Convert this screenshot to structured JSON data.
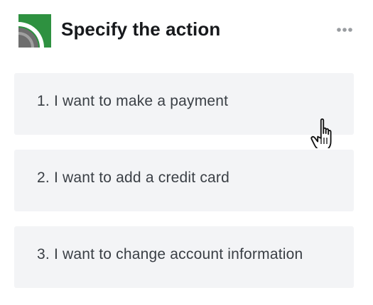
{
  "header": {
    "title": "Specify the action",
    "logo_icon": "road-logo-icon",
    "more_icon": "more-horizontal-icon"
  },
  "options": [
    {
      "label": "1. I want to make a payment"
    },
    {
      "label": "2. I want to add a credit card"
    },
    {
      "label": "3. I want to change account information"
    }
  ],
  "colors": {
    "logo_green": "#2e9140",
    "logo_gray": "#6e6e6e",
    "option_background": "#f3f4f6",
    "option_text": "#3a3f45",
    "title_text": "#17191c"
  }
}
